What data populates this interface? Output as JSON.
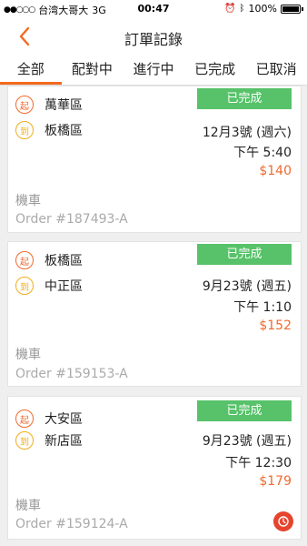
{
  "status_bar": {
    "carrier": "台湾大哥大",
    "network": "3G",
    "time": "00:47",
    "battery": "100%"
  },
  "nav": {
    "title": "訂單記錄",
    "back_icon": "chevron-left-icon"
  },
  "tabs": [
    {
      "label": "全部",
      "active": true
    },
    {
      "label": "配對中"
    },
    {
      "label": "進行中"
    },
    {
      "label": "已完成"
    },
    {
      "label": "已取消"
    }
  ],
  "labels": {
    "start": "起",
    "end": "到"
  },
  "orders": [
    {
      "from": "萬華區",
      "to": "板橋區",
      "status": "已完成",
      "date": "12月3號 (週六)",
      "time": "下午 5:40",
      "price": "$140",
      "vehicle": "機車",
      "order_no": "Order #187493-A"
    },
    {
      "from": "板橋區",
      "to": "中正區",
      "status": "已完成",
      "date": "9月23號 (週五)",
      "time": "下午 1:10",
      "price": "$152",
      "vehicle": "機車",
      "order_no": "Order #159153-A"
    },
    {
      "from": "大安區",
      "to": "新店區",
      "status": "已完成",
      "date": "9月23號 (週五)",
      "time": "下午 12:30",
      "price": "$179",
      "vehicle": "機車",
      "order_no": "Order #159124-A"
    }
  ],
  "colors": {
    "accent": "#f26b1d",
    "status_green": "#57c26a",
    "price": "#ef6a2e"
  }
}
